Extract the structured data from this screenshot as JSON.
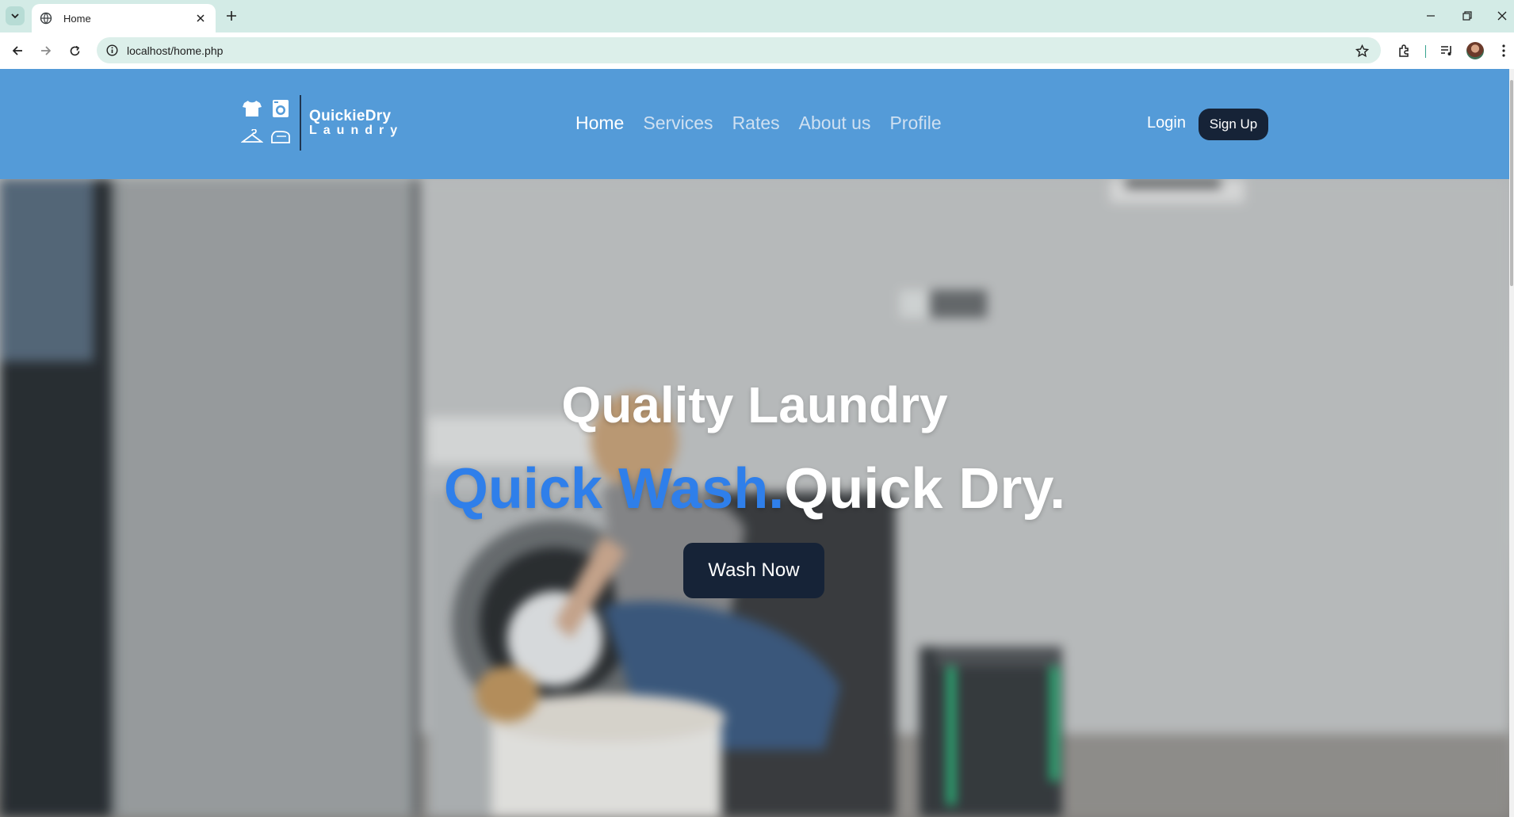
{
  "browser": {
    "tab": {
      "title": "Home"
    },
    "address": {
      "url": "localhost/home.php"
    }
  },
  "site": {
    "logo": {
      "name": "QuickieDry",
      "sub": "Laundry"
    },
    "nav": [
      {
        "label": "Home",
        "active": true
      },
      {
        "label": "Services",
        "active": false
      },
      {
        "label": "Rates",
        "active": false
      },
      {
        "label": "About us",
        "active": false
      },
      {
        "label": "Profile",
        "active": false
      }
    ],
    "auth": {
      "login": "Login",
      "signup": "Sign Up"
    }
  },
  "hero": {
    "line1": "Quality Laundry",
    "line2_accent": "Quick Wash.",
    "line2_rest": "Quick Dry.",
    "cta": "Wash Now"
  },
  "colors": {
    "nav_bg": "#549bd8",
    "button_dark": "#162337",
    "accent_blue": "#2f7fea",
    "browser_frame": "#d3ebe6"
  }
}
